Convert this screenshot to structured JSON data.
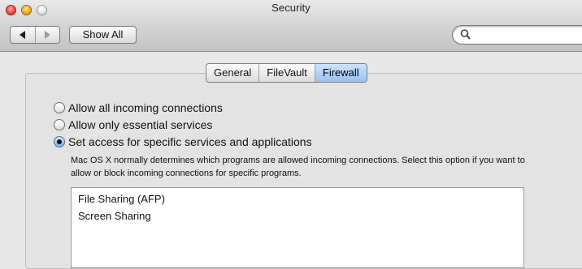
{
  "window": {
    "title": "Security"
  },
  "toolbar": {
    "show_all_label": "Show All",
    "search": {
      "placeholder": "",
      "value": ""
    }
  },
  "tabs": [
    {
      "label": "General",
      "selected": false
    },
    {
      "label": "FileVault",
      "selected": false
    },
    {
      "label": "Firewall",
      "selected": true
    }
  ],
  "firewall": {
    "options": [
      {
        "label": "Allow all incoming connections",
        "checked": false
      },
      {
        "label": "Allow only essential services",
        "checked": false
      },
      {
        "label": "Set access for specific services and applications",
        "checked": true
      }
    ],
    "help_text": "Mac OS X normally determines which programs are allowed incoming connections. Select this option if you want to allow or block incoming connections for specific programs.",
    "services": [
      "File Sharing (AFP)",
      "Screen Sharing"
    ]
  },
  "colors": {
    "tab_selected": "#98c1ef",
    "close": "#f0574c",
    "minimize": "#f4b532"
  }
}
